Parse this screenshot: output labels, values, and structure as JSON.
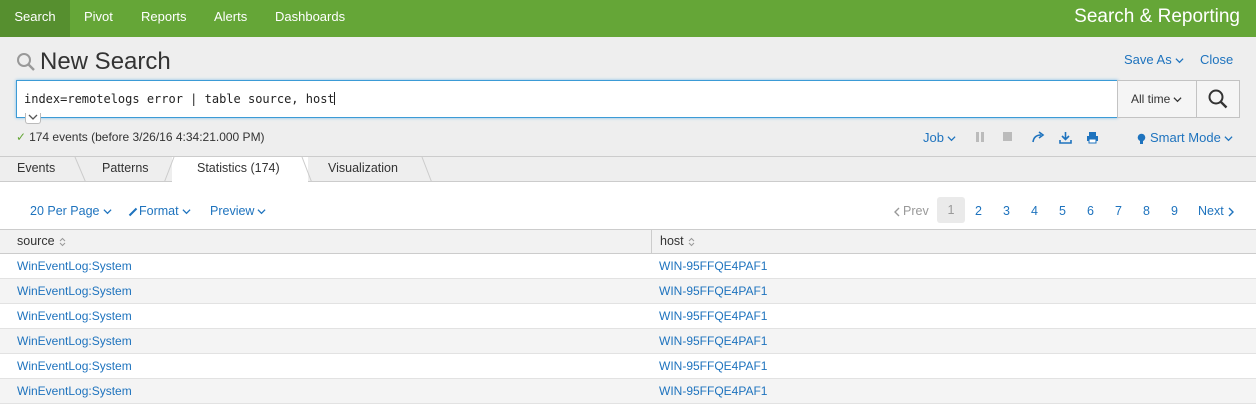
{
  "nav": {
    "items": [
      "Search",
      "Pivot",
      "Reports",
      "Alerts",
      "Dashboards"
    ],
    "active": "Search",
    "app_title": "Search & Reporting"
  },
  "header": {
    "title": "New Search",
    "save_as": "Save As",
    "close": "Close"
  },
  "search": {
    "query": "index=remotelogs error | table source, host",
    "time_range": "All time"
  },
  "status": {
    "text": "174 events (before 3/26/16 4:34:21.000 PM)",
    "job_label": "Job",
    "mode_label": "Smart Mode"
  },
  "tabs": [
    {
      "label": "Events"
    },
    {
      "label": "Patterns"
    },
    {
      "label": "Statistics (174)"
    },
    {
      "label": "Visualization"
    }
  ],
  "active_tab": "Statistics (174)",
  "toolbar": {
    "per_page": "20 Per Page",
    "format": "Format",
    "preview": "Preview"
  },
  "pagination": {
    "prev": "Prev",
    "pages": [
      "1",
      "2",
      "3",
      "4",
      "5",
      "6",
      "7",
      "8",
      "9"
    ],
    "current": "1",
    "next": "Next"
  },
  "table": {
    "columns": [
      "source",
      "host"
    ],
    "rows": [
      [
        "WinEventLog:System",
        "WIN-95FFQE4PAF1"
      ],
      [
        "WinEventLog:System",
        "WIN-95FFQE4PAF1"
      ],
      [
        "WinEventLog:System",
        "WIN-95FFQE4PAF1"
      ],
      [
        "WinEventLog:System",
        "WIN-95FFQE4PAF1"
      ],
      [
        "WinEventLog:System",
        "WIN-95FFQE4PAF1"
      ],
      [
        "WinEventLog:System",
        "WIN-95FFQE4PAF1"
      ]
    ]
  },
  "colors": {
    "nav_green": "#65a637",
    "link_blue": "#1e73be"
  }
}
